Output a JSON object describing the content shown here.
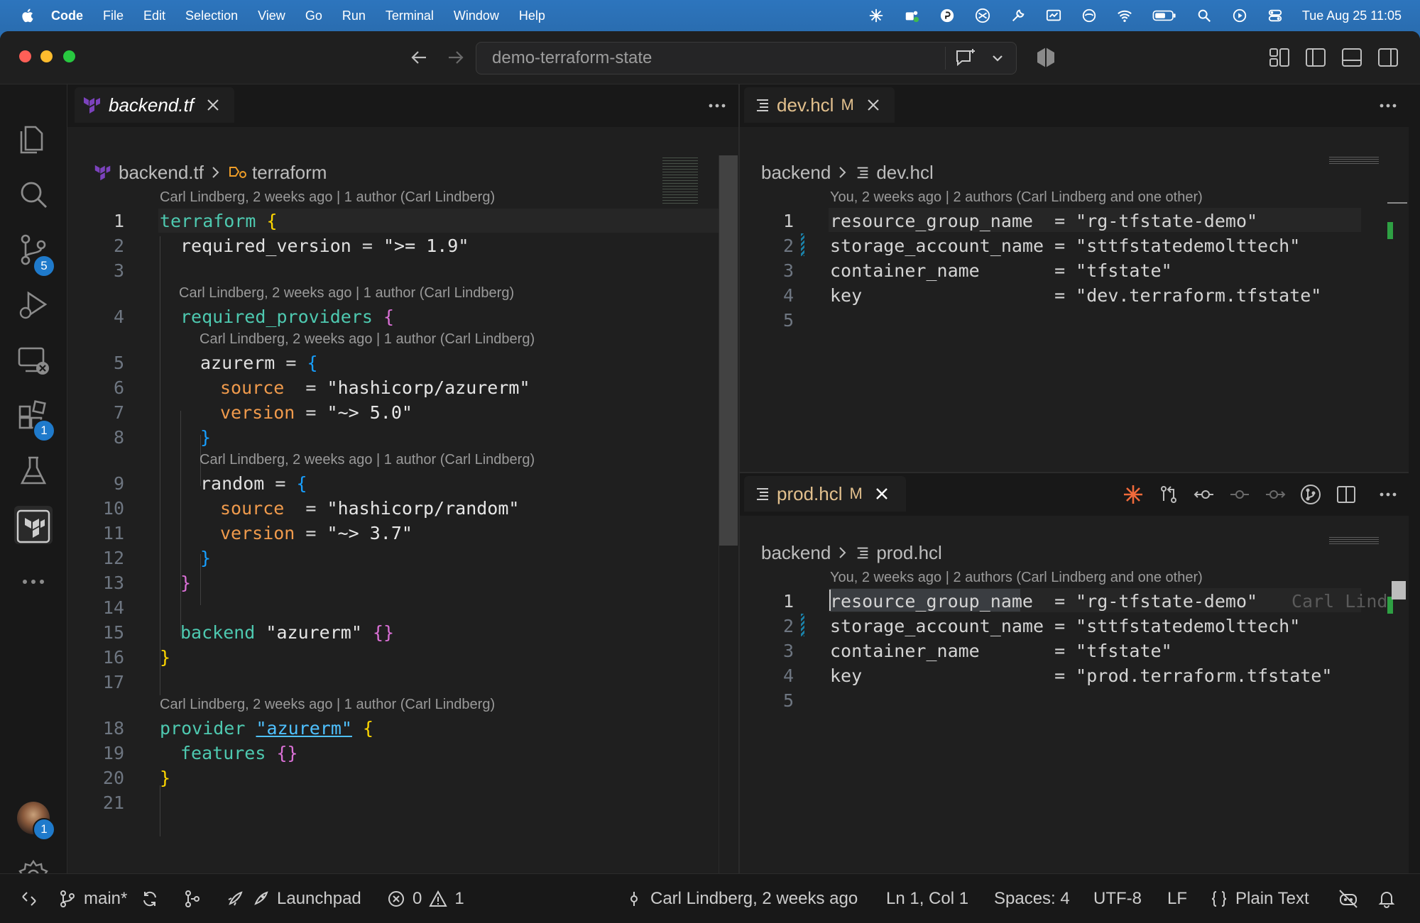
{
  "menubar": {
    "app": "Code",
    "items": [
      "File",
      "Edit",
      "Selection",
      "View",
      "Go",
      "Run",
      "Terminal",
      "Window",
      "Help"
    ],
    "clock": "Tue Aug 25  11:05"
  },
  "titlebar": {
    "search": "demo-terraform-state"
  },
  "activity": {
    "scm_badge": "5",
    "ext_badge": "1",
    "account_badge": "1"
  },
  "left_editor": {
    "tab": "backend.tf",
    "breadcrumb": [
      "backend.tf",
      "terraform"
    ],
    "lenses": {
      "l1": "Carl Lindberg, 2 weeks ago | 1 author (Carl Lindberg)",
      "l4": "Carl Lindberg, 2 weeks ago | 1 author (Carl Lindberg)",
      "l5": "Carl Lindberg, 2 weeks ago | 1 author (Carl Lindberg)",
      "l9": "Carl Lindberg, 2 weeks ago | 1 author (Carl Lindberg)",
      "l18": "Carl Lindberg, 2 weeks ago | 1 author (Carl Lindberg)"
    },
    "lines": {
      "1": [
        "terraform",
        " {"
      ],
      "2": [
        "required_version",
        " = ",
        "\">= 1.9\""
      ],
      "4": [
        "required_providers",
        " {"
      ],
      "5": [
        "azurerm",
        " = ",
        "{"
      ],
      "6": [
        "source",
        "  = ",
        "\"hashicorp/azurerm\""
      ],
      "7": [
        "version",
        " = ",
        "\"~> 5.0\""
      ],
      "8": [
        "}"
      ],
      "9": [
        "random",
        " = ",
        "{"
      ],
      "10": [
        "source",
        "  = ",
        "\"hashicorp/random\""
      ],
      "11": [
        "version",
        " = ",
        "\"~> 3.7\""
      ],
      "12": [
        "}"
      ],
      "13": [
        "}"
      ],
      "15": [
        "backend",
        " ",
        "\"azurerm\"",
        " {}"
      ],
      "16": [
        "}"
      ],
      "18": [
        "provider",
        " ",
        "\"azurerm\"",
        " {"
      ],
      "19": [
        "features",
        " {}"
      ],
      "20": [
        "}"
      ]
    }
  },
  "right_top": {
    "tab": "dev.hcl",
    "modified": "M",
    "breadcrumb": [
      "backend",
      "dev.hcl"
    ],
    "lens": "You, 2 weeks ago | 2 authors (Carl Lindberg and one other)",
    "lines": [
      "resource_group_name  = \"rg-tfstate-demo\"",
      "storage_account_name = \"sttfstatedemolttech\"",
      "container_name       = \"tfstate\"",
      "key                  = \"dev.terraform.tfstate\"",
      ""
    ]
  },
  "right_bottom": {
    "tab": "prod.hcl",
    "modified": "M",
    "breadcrumb": [
      "backend",
      "prod.hcl"
    ],
    "lens": "You, 2 weeks ago | 2 authors (Carl Lindberg and one other)",
    "inline_blame": "Carl Lind",
    "lines": [
      "resource_group_name  = \"rg-tfstate-demo\"",
      "storage_account_name = \"sttfstatedemolttech\"",
      "container_name       = \"tfstate\"",
      "key                  = \"prod.terraform.tfstate\"",
      ""
    ]
  },
  "status": {
    "branch": "main*",
    "launchpad": "Launchpad",
    "errors": "0",
    "warnings": "1",
    "blame": "Carl Lindberg, 2 weeks ago",
    "position": "Ln 1, Col 1",
    "spaces": "Spaces: 4",
    "encoding": "UTF-8",
    "eol": "LF",
    "language": "Plain Text"
  },
  "colors": {
    "terraform_purple": "#7b42bc",
    "modified": "#e2c08d",
    "badge": "#1f7acb"
  }
}
